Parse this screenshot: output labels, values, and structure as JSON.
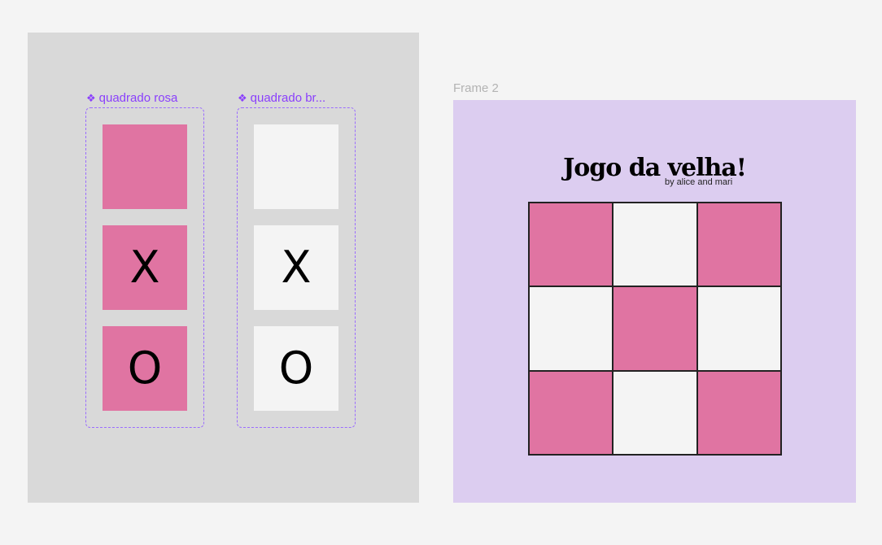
{
  "components": {
    "pink": {
      "label": "quadrado rosa",
      "x_glyph": "X",
      "o_glyph": "O"
    },
    "white": {
      "label": "quadrado br...",
      "x_glyph": "X",
      "o_glyph": "O"
    },
    "component_icon": "❖"
  },
  "frame": {
    "label": "Frame 2",
    "title": "Jogo da velha!",
    "subtitle": "by alice and mari",
    "board": [
      "pink",
      "white",
      "pink",
      "white",
      "pink",
      "white",
      "pink",
      "white",
      "pink"
    ]
  },
  "colors": {
    "pink": "#e074a2",
    "white": "#f4f4f4",
    "frame_bg": "#dccdf0",
    "component_purple": "#8a3ffc"
  }
}
